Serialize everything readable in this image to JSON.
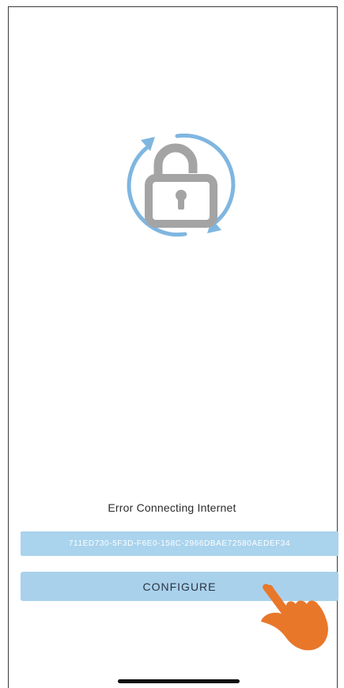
{
  "icons": {
    "sync_lock": "unlocked-padlock-sync-icon",
    "hand_pointer": "hand-pointer-icon"
  },
  "colors": {
    "accent_blue": "#7fb6e0",
    "button_bg": "#a9d1ec",
    "lock_gray": "#a4a4a4",
    "hand_orange": "#e8772a"
  },
  "status": {
    "message": "Error Connecting Internet"
  },
  "device": {
    "id": "711ED730-5F3D-F6E0-158C-2966DBAE72580AEDEF34"
  },
  "actions": {
    "configure_label": "CONFIGURE"
  }
}
